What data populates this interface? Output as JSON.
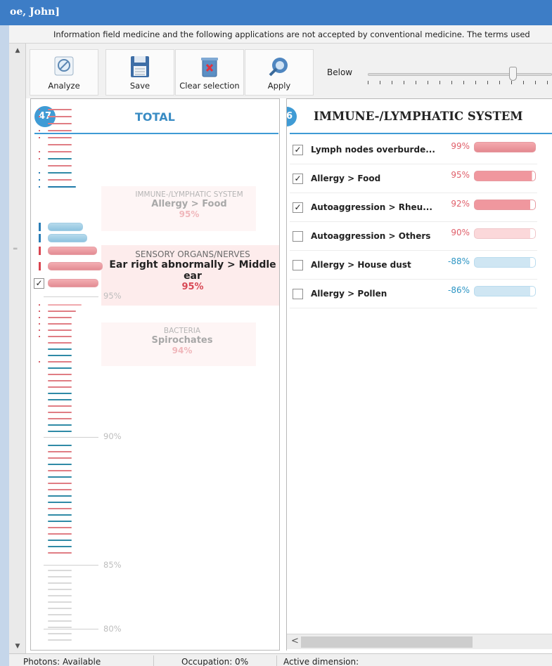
{
  "window": {
    "title": "oe, John]"
  },
  "info": {
    "text": "Information field medicine and the following applications are not accepted by conventional medicine. The terms used"
  },
  "toolbar": {
    "analyze": "Analyze",
    "save": "Save",
    "clear_selection": "Clear selection",
    "apply": "Apply",
    "below_label": "Below",
    "slider_value_fraction": 0.8
  },
  "left": {
    "count": "47",
    "title": "TOTAL",
    "axis": {
      "t95": "95%",
      "t90": "90%",
      "t85": "85%",
      "t80": "80%"
    },
    "callouts": [
      {
        "category": "IMMUNE-/LYMPHATIC SYSTEM",
        "item": "Allergy > Food",
        "pct": "95%"
      },
      {
        "category": "SENSORY ORGANS/NERVES",
        "item": "Ear right abnormally > Middle ear",
        "pct": "95%"
      },
      {
        "category": "BACTERIA",
        "item": "Spirochates",
        "pct": "94%"
      }
    ]
  },
  "right": {
    "count": "6",
    "title": "IMMUNE-/LYMPHATIC SYSTEM",
    "rows": [
      {
        "label": "Lymph nodes overburde...",
        "pct": "99%",
        "checked": true
      },
      {
        "label": "Allergy > Food",
        "pct": "95%",
        "checked": true
      },
      {
        "label": "Autoaggression > Rheu...",
        "pct": "92%",
        "checked": true
      },
      {
        "label": "Autoaggression > Others",
        "pct": "90%",
        "checked": false
      },
      {
        "label": "Allergy > House dust",
        "pct": "-88%",
        "checked": false
      },
      {
        "label": "Allergy > Pollen",
        "pct": "-86%",
        "checked": false
      }
    ]
  },
  "status": {
    "photons": "Photons: Available",
    "occupation": "Occupation: 0%",
    "dimension": "Active dimension:"
  },
  "colors": {
    "accent": "#3f9bd5",
    "positive": "#e0606b",
    "negative": "#2d95c4"
  }
}
